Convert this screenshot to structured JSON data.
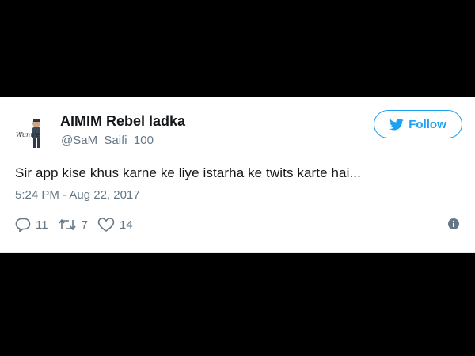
{
  "tweet": {
    "display_name": "AIMIM Rebel ladka",
    "handle": "@SaM_Saifi_100",
    "avatar_text": "Wunn'e",
    "text": "Sir app kise khus karne ke liye istarha ke twits karte hai...",
    "timestamp": "5:24 PM - Aug 22, 2017",
    "follow_label": "Follow",
    "actions": {
      "replies": "11",
      "retweets": "7",
      "likes": "14"
    }
  },
  "colors": {
    "brand": "#1da1f2",
    "secondary_text": "#657786",
    "primary_text": "#14171a",
    "background": "#000000"
  },
  "icons": {
    "follow": "twitter-bird-icon",
    "reply": "reply-icon",
    "retweet": "retweet-icon",
    "like": "heart-icon",
    "info": "info-icon"
  }
}
